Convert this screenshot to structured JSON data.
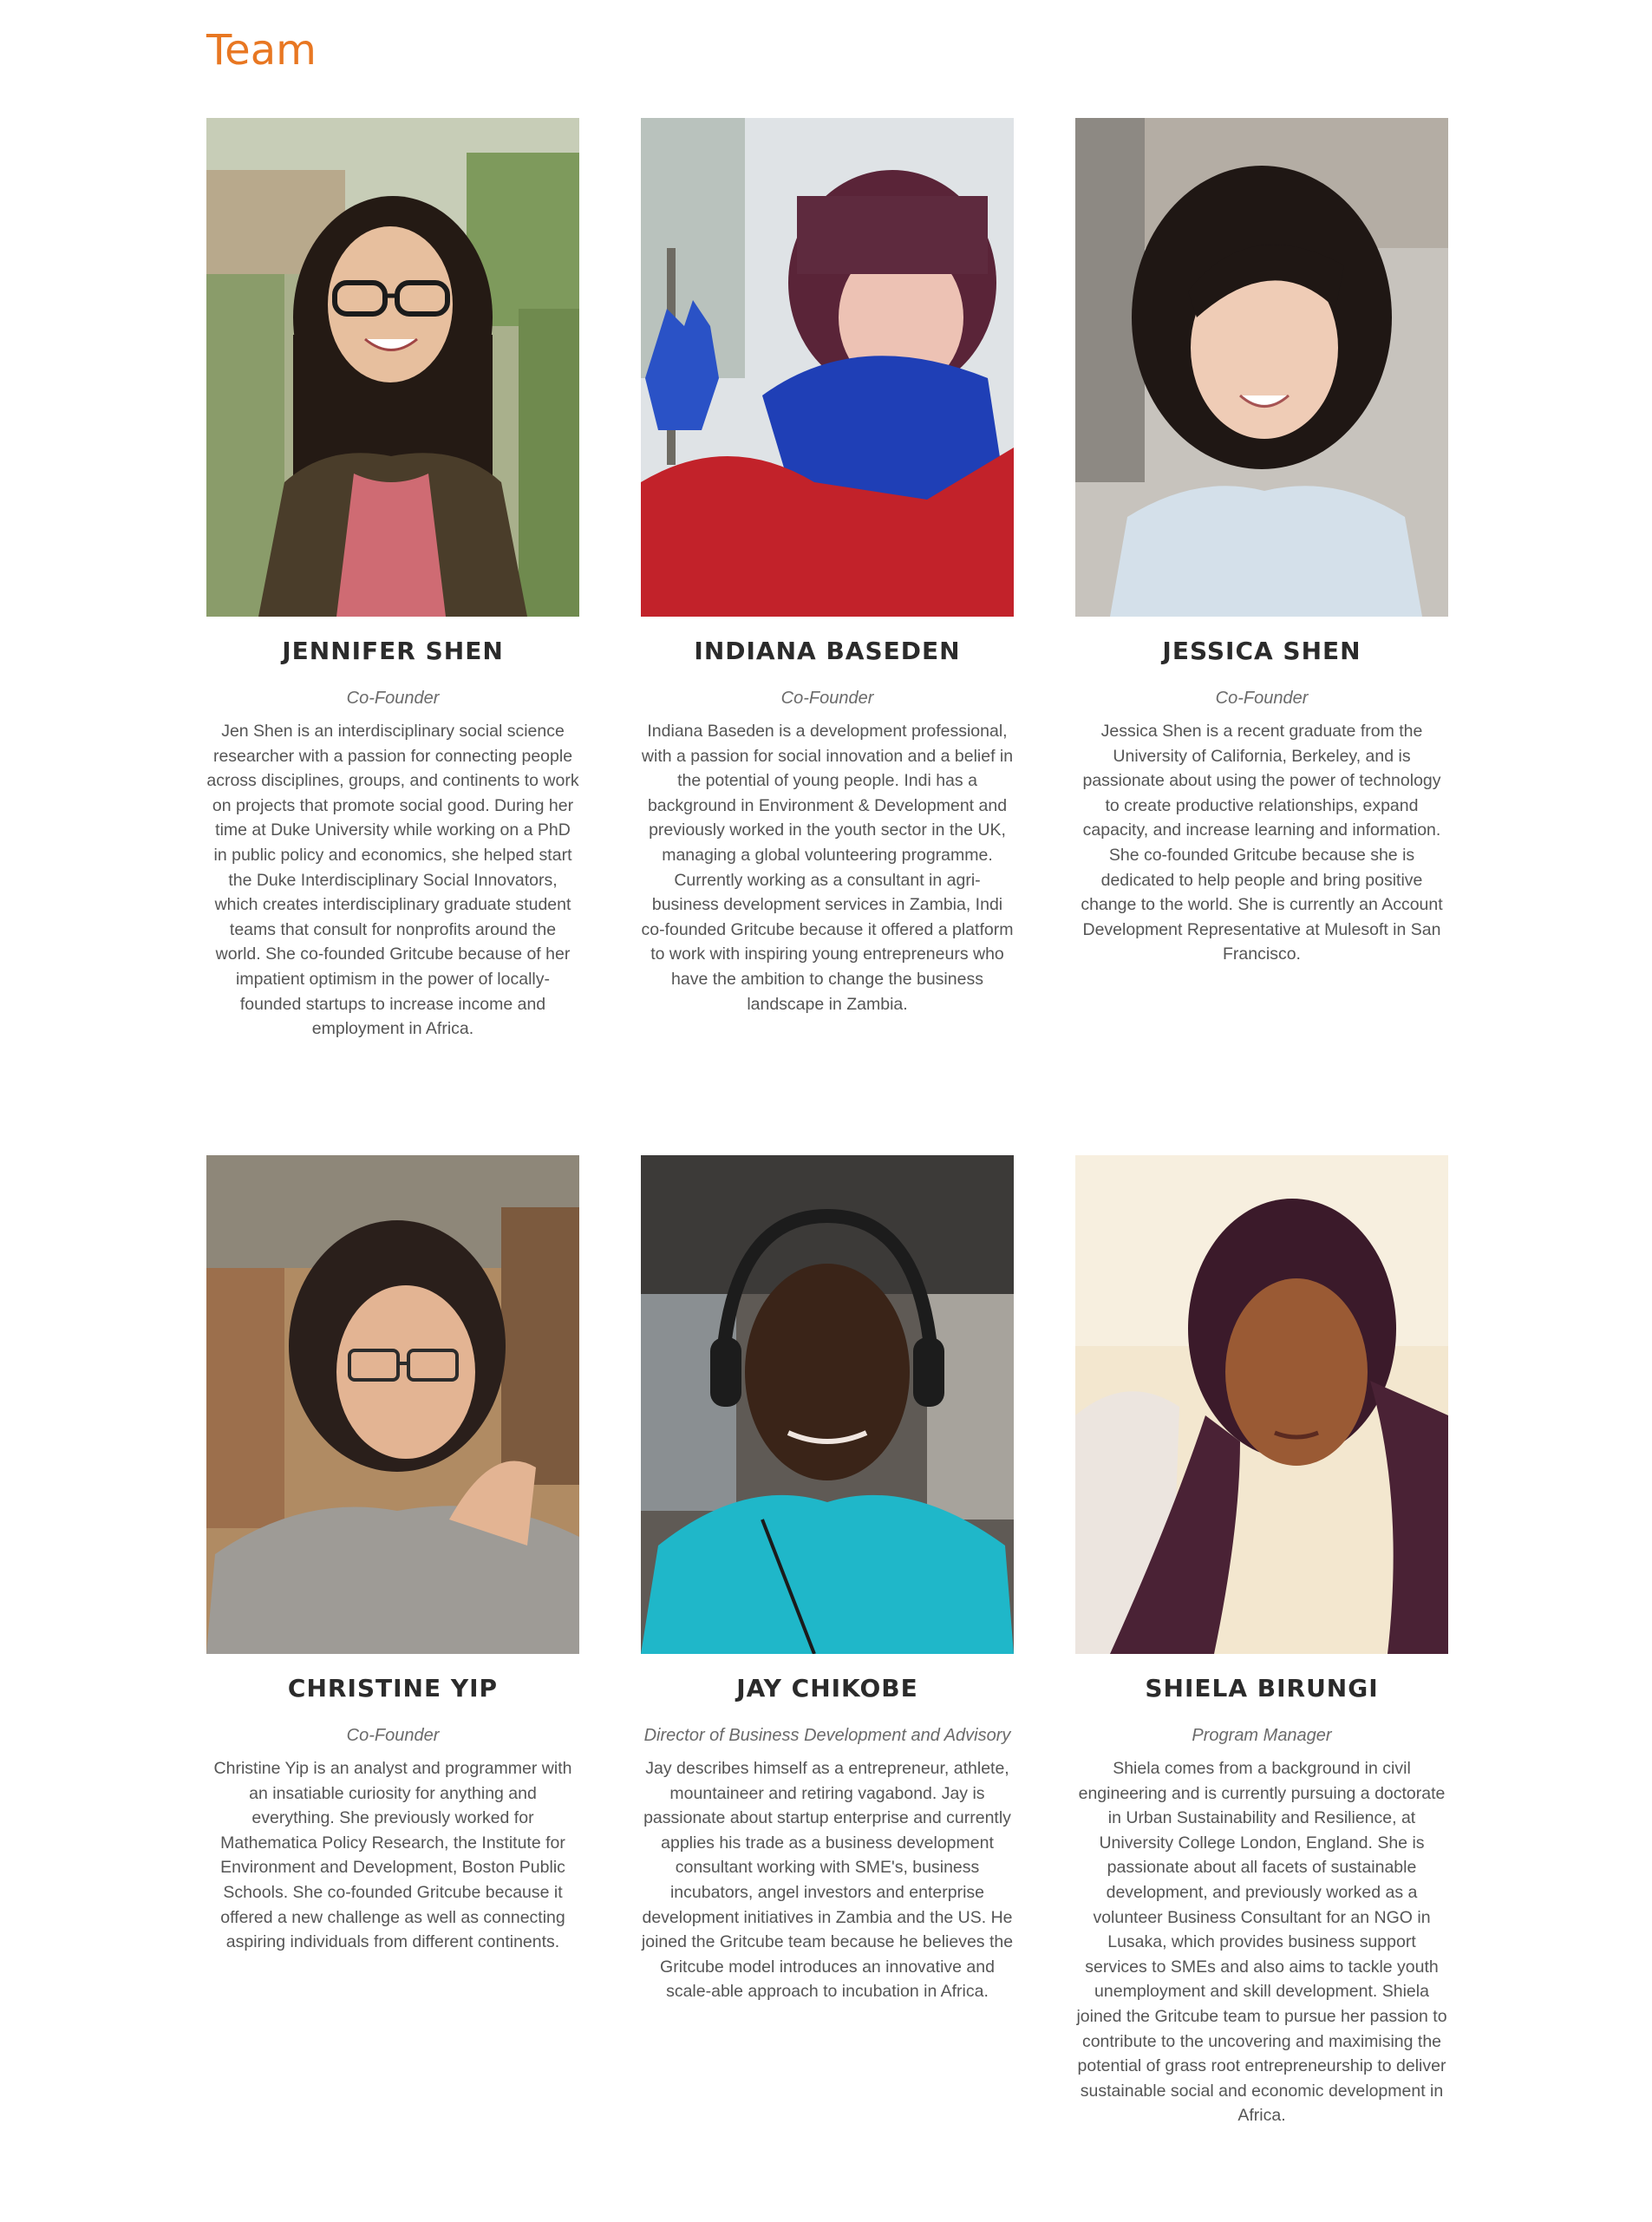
{
  "section": {
    "title": "Team",
    "accent_color": "#e87722"
  },
  "members": [
    {
      "name": "JENNIFER SHEN",
      "role": "Co-Founder",
      "bio": "Jen Shen is an interdisciplinary social science researcher with a passion for connecting people across disciplines, groups, and continents to work on projects that promote social good. During her time at Duke University while working on a PhD in public policy and economics, she helped start the Duke Interdisciplinary Social Innovators, which creates interdisciplinary graduate student teams that consult for nonprofits around the world. She co-founded Gritcube because of her impatient optimism in the power of locally-founded startups to increase income and employment in Africa."
    },
    {
      "name": "INDIANA BASEDEN",
      "role": "Co-Founder",
      "bio": "Indiana Baseden is a development professional, with a passion for social innovation and a belief in the potential of young people. Indi has a background in Environment & Development and previously worked in the youth sector in the UK, managing a global volunteering programme. Currently working as a consultant in agri-business development services in Zambia, Indi co-founded Gritcube because it offered a platform to work with inspiring young entrepreneurs who have the ambition to change the business landscape in Zambia."
    },
    {
      "name": "JESSICA SHEN",
      "role": "Co-Founder",
      "bio": "Jessica Shen is a recent graduate from the University of California, Berkeley, and is passionate about using the power of technology to create productive relationships, expand capacity, and increase learning and information. She co-founded Gritcube because she is dedicated to help people and bring positive change to the world. She is currently an Account Development Representative at Mulesoft in San Francisco."
    },
    {
      "name": "CHRISTINE YIP",
      "role": "Co-Founder",
      "bio": "Christine Yip is an analyst and programmer with an insatiable curiosity for anything and everything. She previously worked for Mathematica Policy Research, the Institute for Environment and Development, Boston Public Schools. She co-founded Gritcube because it offered a new challenge as well as connecting aspiring individuals from different continents."
    },
    {
      "name": "JAY CHIKOBE",
      "role": "Director of Business Development and Advisory",
      "bio": "Jay describes himself as a entrepreneur, athlete, mountaineer and retiring vagabond. Jay is passionate about startup enterprise and currently applies his trade as a business development consultant working with SME's, business incubators, angel investors and enterprise development initiatives in Zambia and the US. He joined the Gritcube team because he believes the Gritcube model introduces an innovative and scale-able approach to incubation in Africa."
    },
    {
      "name": "SHIELA BIRUNGI",
      "role": "Program Manager",
      "bio": "Shiela comes from a background in civil engineering and is currently pursuing a doctorate in Urban Sustainability and Resilience, at University College London, England. She is passionate about all facets of sustainable development, and previously worked as a volunteer Business Consultant for an NGO in Lusaka, which provides business support services to SMEs and also aims to tackle youth unemployment and skill development. Shiela joined the Gritcube team to pursue her passion to contribute to the uncovering and maximising the potential of grass root entrepreneurship to deliver sustainable social and economic development in Africa."
    }
  ]
}
